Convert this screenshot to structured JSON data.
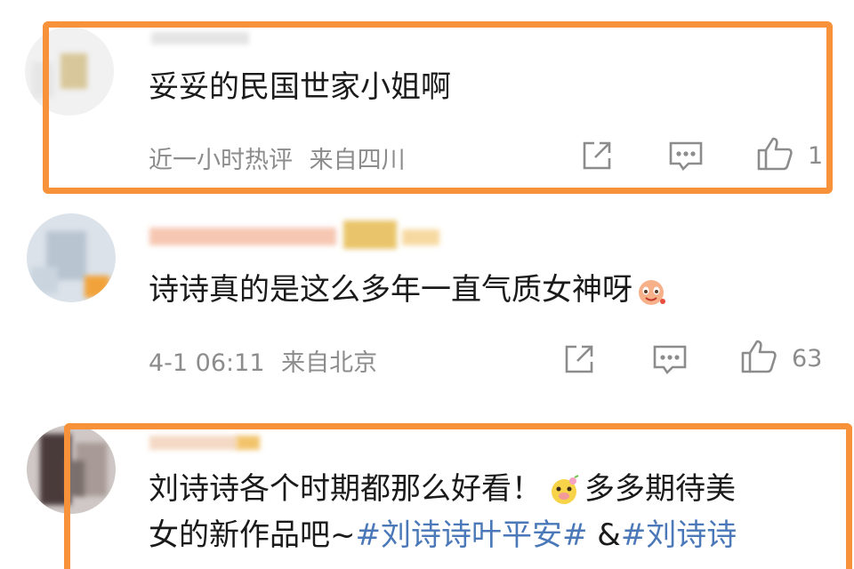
{
  "comments": [
    {
      "text": "妥妥的民国世家小姐啊",
      "time": "近一小时热评",
      "location": "来自四川",
      "likes": "1",
      "highlighted": true
    },
    {
      "text": "诗诗真的是这么多年一直气质女神呀",
      "time": "4-1 06:11",
      "location": "来自北京",
      "likes": "63",
      "highlighted": false
    },
    {
      "text_line1": "刘诗诗各个时期都那么好看！",
      "text_line1_b": "多多期待美",
      "text_line2_a": "女的新作品吧~",
      "hashtag1": "#刘诗诗叶平安#",
      "amp": " &",
      "hashtag2": "#刘诗诗",
      "highlighted": true
    }
  ],
  "icons": [
    "share-icon",
    "comment-icon",
    "like-icon"
  ],
  "colors": {
    "highlight": "#f7923a",
    "hashtag": "#4a78b8",
    "meta": "#8c8c8c",
    "text": "#1a1a1a"
  }
}
